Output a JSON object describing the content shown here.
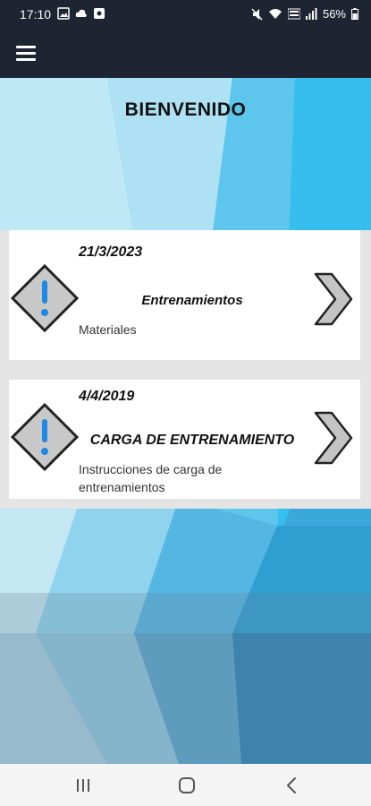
{
  "status_bar": {
    "time": "17:10",
    "battery": "56%",
    "left_icons": [
      "image-icon",
      "cloud-icon",
      "app-notification-icon"
    ],
    "right_icons": [
      "mute-icon",
      "wifi-icon",
      "volte-icon",
      "signal-icon",
      "battery-icon"
    ]
  },
  "header": {
    "menu_icon": "hamburger-menu-icon"
  },
  "main": {
    "title": "BIENVENIDO",
    "cards": [
      {
        "date": "21/3/2023",
        "title": "Entrenamientos",
        "description": "Materiales",
        "icon": "warning-exclamation-icon",
        "action_icon": "chevron-right-icon"
      },
      {
        "date": "4/4/2019",
        "title": "CARGA DE ENTRENAMIENTO",
        "description": "Instrucciones de carga de entrenamientos",
        "icon": "warning-exclamation-icon",
        "action_icon": "chevron-right-icon"
      }
    ]
  },
  "nav_bar": {
    "buttons": [
      "recents-icon",
      "home-icon",
      "back-icon"
    ]
  },
  "colors": {
    "bar_dark": "#1f2433",
    "accent_blue": "#3aa9d9",
    "icon_blue": "#1e88e5",
    "icon_gray": "#c8c8c8"
  }
}
